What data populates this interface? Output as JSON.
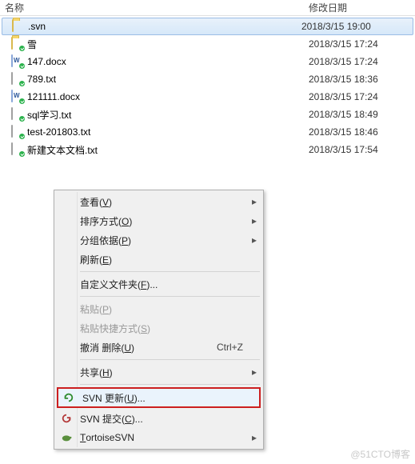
{
  "header": {
    "name_col": "名称",
    "date_col": "修改日期"
  },
  "files": [
    {
      "icon": "folder",
      "name": ".svn",
      "date": "2018/3/15 19:00",
      "selected": true
    },
    {
      "icon": "folder",
      "overlay": true,
      "name": "雪",
      "date": "2018/3/15 17:24"
    },
    {
      "icon": "doc",
      "overlay": true,
      "name": "147.docx",
      "date": "2018/3/15 17:24"
    },
    {
      "icon": "txt",
      "overlay": true,
      "name": "789.txt",
      "date": "2018/3/15 18:36"
    },
    {
      "icon": "doc",
      "overlay": true,
      "name": "121111.docx",
      "date": "2018/3/15 17:24"
    },
    {
      "icon": "txt",
      "overlay": true,
      "name": "sql学习.txt",
      "date": "2018/3/15 18:49"
    },
    {
      "icon": "txt",
      "overlay": true,
      "name": "test-201803.txt",
      "date": "2018/3/15 18:46"
    },
    {
      "icon": "txt",
      "overlay": true,
      "name": "新建文本文档.txt",
      "date": "2018/3/15 17:54"
    }
  ],
  "menu": {
    "view": "查看(",
    "view_u": "V",
    "view_end": ")",
    "sort": "排序方式(",
    "sort_u": "O",
    "sort_end": ")",
    "group": "分组依据(",
    "group_u": "P",
    "group_end": ")",
    "refresh": "刷新(",
    "refresh_u": "E",
    "refresh_end": ")",
    "customize": "自定义文件夹(",
    "customize_u": "F",
    "customize_end": ")...",
    "paste": "粘贴(",
    "paste_u": "P",
    "paste_end": ")",
    "paste_lnk": "粘贴快捷方式(",
    "paste_lnk_u": "S",
    "paste_lnk_end": ")",
    "undo": "撤消 删除(",
    "undo_u": "U",
    "undo_end": ")",
    "undo_short": "Ctrl+Z",
    "share": "共享(",
    "share_u": "H",
    "share_end": ")",
    "svn_update": "SVN 更新(",
    "svn_update_u": "U",
    "svn_update_end": ")...",
    "svn_commit": "SVN 提交(",
    "svn_commit_u": "C",
    "svn_commit_end": ")...",
    "tortoise_pre": "",
    "tortoise_u": "T",
    "tortoise_label": "ortoiseSVN"
  },
  "watermark": "@51CTO博客"
}
